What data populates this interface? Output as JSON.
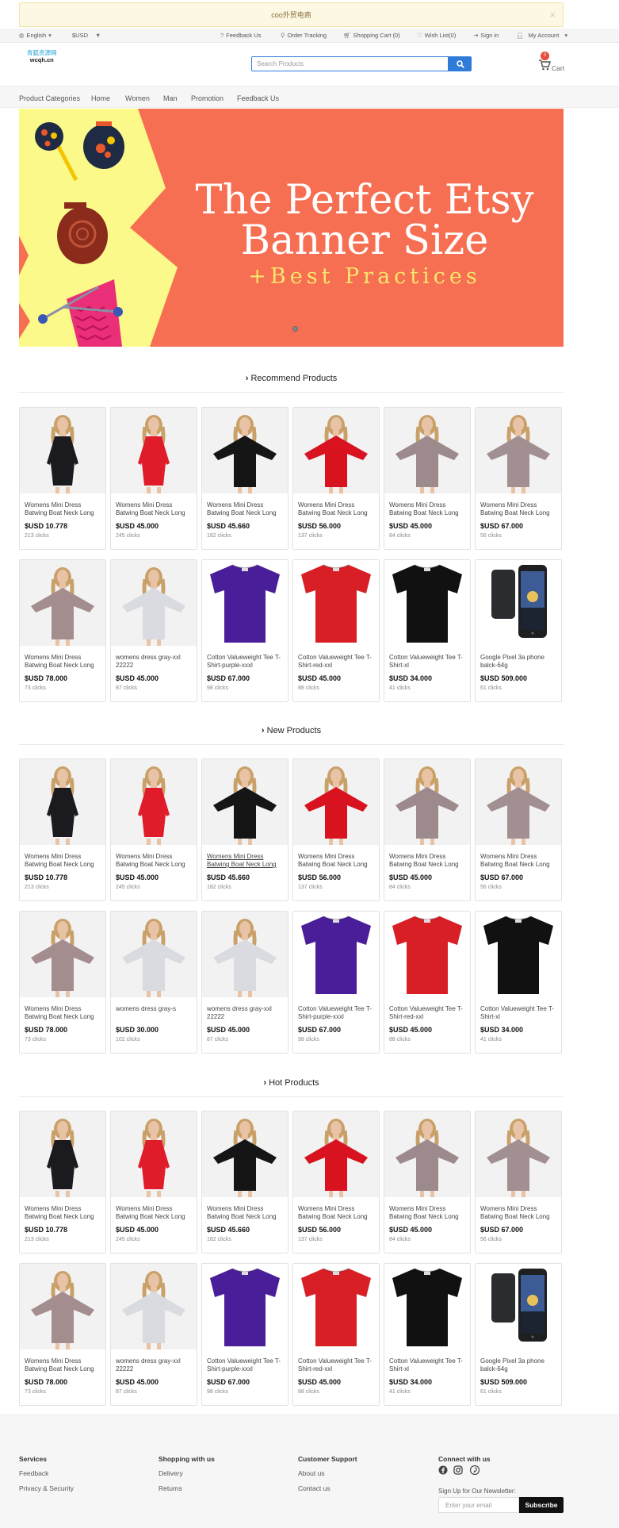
{
  "notice": {
    "text": "coo外贸电商",
    "close": "×"
  },
  "topbar": {
    "language": "English",
    "currency": "$USD",
    "feedback": "Feedback Us",
    "order_tracking": "Order Tracking",
    "shopping_cart": "Shopping Cart (0)",
    "wish_list": "Wish List(0)",
    "sign_in": "Sign in",
    "my_account": "My Account"
  },
  "logo": {
    "line1": "青狐资源网",
    "line2": "wcqh.cn"
  },
  "search": {
    "placeholder": "Search Products"
  },
  "cart": {
    "count": "0",
    "label": "Cart"
  },
  "nav": {
    "items": [
      "Product Categories",
      "Home",
      "Women",
      "Man",
      "Promotion",
      "Feedback Us"
    ]
  },
  "banner": {
    "line1": "The Perfect Etsy",
    "line2": "Banner Size",
    "line3": "+Best Practices"
  },
  "colors": {
    "accent": "#2f7bd9",
    "banner_bg": "#f76f52",
    "banner_yellow": "#fbf98a",
    "badge": "#e74c3c"
  },
  "sections": {
    "recommend": {
      "title": "Recommend Products",
      "products": [
        {
          "title": "Womens Mini Dress Batwing Boat Neck Long",
          "price": "$USD 10.778",
          "clicks": "213 clicks",
          "img": "dress-black"
        },
        {
          "title": "Womens Mini Dress Batwing Boat Neck Long",
          "price": "$USD 45.000",
          "clicks": "245 clicks",
          "img": "dress-red"
        },
        {
          "title": "Womens Mini Dress Batwing Boat Neck Long",
          "price": "$USD 45.660",
          "clicks": "182 clicks",
          "img": "batwing-black"
        },
        {
          "title": "Womens Mini Dress Batwing Boat Neck Long",
          "price": "$USD 56.000",
          "clicks": "137 clicks",
          "img": "batwing-red"
        },
        {
          "title": "Womens Mini Dress Batwing Boat Neck Long",
          "price": "$USD 45.000",
          "clicks": "84 clicks",
          "img": "dress-mauve"
        },
        {
          "title": "Womens Mini Dress Batwing Boat Neck Long",
          "price": "$USD 67.000",
          "clicks": "56 clicks",
          "img": "batwing-mauve"
        },
        {
          "title": "Womens Mini Dress Batwing Boat Neck Long",
          "price": "$USD 78.000",
          "clicks": "73 clicks",
          "img": "oversize-mauve"
        },
        {
          "title": "womens dress gray-xxl 22222",
          "price": "$USD 45.000",
          "clicks": "87 clicks",
          "img": "dress-gray"
        },
        {
          "title": "Cotton Valueweight Tee T-Shirt-purple-xxxl",
          "price": "$USD 67.000",
          "clicks": "98 clicks",
          "img": "tee-purple"
        },
        {
          "title": "Cotton Valueweight Tee T-Shirt-red-xxl",
          "price": "$USD 45.000",
          "clicks": "88 clicks",
          "img": "tee-red"
        },
        {
          "title": "Cotton Valueweight Tee T-Shirt-xl",
          "price": "$USD 34.000",
          "clicks": "41 clicks",
          "img": "tee-black"
        },
        {
          "title": "Google Pixel 3a phone balck-64g",
          "price": "$USD 509.000",
          "clicks": "61 clicks",
          "img": "phone"
        }
      ]
    },
    "new": {
      "title": "New Products",
      "products": [
        {
          "title": "Womens Mini Dress Batwing Boat Neck Long",
          "price": "$USD 10.778",
          "clicks": "213 clicks",
          "img": "dress-black"
        },
        {
          "title": "Womens Mini Dress Batwing Boat Neck Long",
          "price": "$USD 45.000",
          "clicks": "245 clicks",
          "img": "dress-red"
        },
        {
          "title": "Womens Mini Dress Batwing Boat Neck Long",
          "price": "$USD 45.660",
          "clicks": "182 clicks",
          "img": "batwing-black"
        },
        {
          "title": "Womens Mini Dress Batwing Boat Neck Long",
          "price": "$USD 56.000",
          "clicks": "137 clicks",
          "img": "batwing-red"
        },
        {
          "title": "Womens Mini Dress Batwing Boat Neck Long",
          "price": "$USD 45.000",
          "clicks": "84 clicks",
          "img": "dress-mauve"
        },
        {
          "title": "Womens Mini Dress Batwing Boat Neck Long",
          "price": "$USD 67.000",
          "clicks": "56 clicks",
          "img": "batwing-mauve"
        },
        {
          "title": "Womens Mini Dress Batwing Boat Neck Long",
          "price": "$USD 78.000",
          "clicks": "73 clicks",
          "img": "oversize-mauve"
        },
        {
          "title": "womens dress gray-s",
          "price": "$USD 30.000",
          "clicks": "102 clicks",
          "img": "dress-gray"
        },
        {
          "title": "womens dress gray-xxl 22222",
          "price": "$USD 45.000",
          "clicks": "87 clicks",
          "img": "dress-gray"
        },
        {
          "title": "Cotton Valueweight Tee T-Shirt-purple-xxxl",
          "price": "$USD 67.000",
          "clicks": "98 clicks",
          "img": "tee-purple"
        },
        {
          "title": "Cotton Valueweight Tee T-Shirt-red-xxl",
          "price": "$USD 45.000",
          "clicks": "88 clicks",
          "img": "tee-red"
        },
        {
          "title": "Cotton Valueweight Tee T-Shirt-xl",
          "price": "$USD 34.000",
          "clicks": "41 clicks",
          "img": "tee-black"
        }
      ]
    },
    "hot": {
      "title": "Hot Products",
      "products": [
        {
          "title": "Womens Mini Dress Batwing Boat Neck Long",
          "price": "$USD 10.778",
          "clicks": "213 clicks",
          "img": "dress-black"
        },
        {
          "title": "Womens Mini Dress Batwing Boat Neck Long",
          "price": "$USD 45.000",
          "clicks": "245 clicks",
          "img": "dress-red"
        },
        {
          "title": "Womens Mini Dress Batwing Boat Neck Long",
          "price": "$USD 45.660",
          "clicks": "182 clicks",
          "img": "batwing-black"
        },
        {
          "title": "Womens Mini Dress Batwing Boat Neck Long",
          "price": "$USD 56.000",
          "clicks": "137 clicks",
          "img": "batwing-red"
        },
        {
          "title": "Womens Mini Dress Batwing Boat Neck Long",
          "price": "$USD 45.000",
          "clicks": "84 clicks",
          "img": "dress-mauve"
        },
        {
          "title": "Womens Mini Dress Batwing Boat Neck Long",
          "price": "$USD 67.000",
          "clicks": "56 clicks",
          "img": "batwing-mauve"
        },
        {
          "title": "Womens Mini Dress Batwing Boat Neck Long",
          "price": "$USD 78.000",
          "clicks": "73 clicks",
          "img": "oversize-mauve"
        },
        {
          "title": "womens dress gray-xxl 22222",
          "price": "$USD 45.000",
          "clicks": "87 clicks",
          "img": "dress-gray"
        },
        {
          "title": "Cotton Valueweight Tee T-Shirt-purple-xxxl",
          "price": "$USD 67.000",
          "clicks": "98 clicks",
          "img": "tee-purple"
        },
        {
          "title": "Cotton Valueweight Tee T-Shirt-red-xxl",
          "price": "$USD 45.000",
          "clicks": "88 clicks",
          "img": "tee-red"
        },
        {
          "title": "Cotton Valueweight Tee T-Shirt-xl",
          "price": "$USD 34.000",
          "clicks": "41 clicks",
          "img": "tee-black"
        },
        {
          "title": "Google Pixel 3a phone balck-64g",
          "price": "$USD 509.000",
          "clicks": "61 clicks",
          "img": "phone"
        }
      ]
    }
  },
  "footer": {
    "services": {
      "heading": "Services",
      "links": [
        "Feedback",
        "Privacy & Security"
      ]
    },
    "shopping": {
      "heading": "Shopping with us",
      "links": [
        "Delivery",
        "Returns"
      ]
    },
    "support": {
      "heading": "Customer Support",
      "links": [
        "About us",
        "Contact us"
      ]
    },
    "connect": {
      "heading": "Connect with us",
      "icons": [
        "facebook-icon",
        "instagram-icon",
        "pinterest-icon"
      ],
      "newsletter": "Sign Up for Our Newsletter:",
      "email_placeholder": "Enter your email",
      "subscribe": "Subscribe"
    }
  }
}
